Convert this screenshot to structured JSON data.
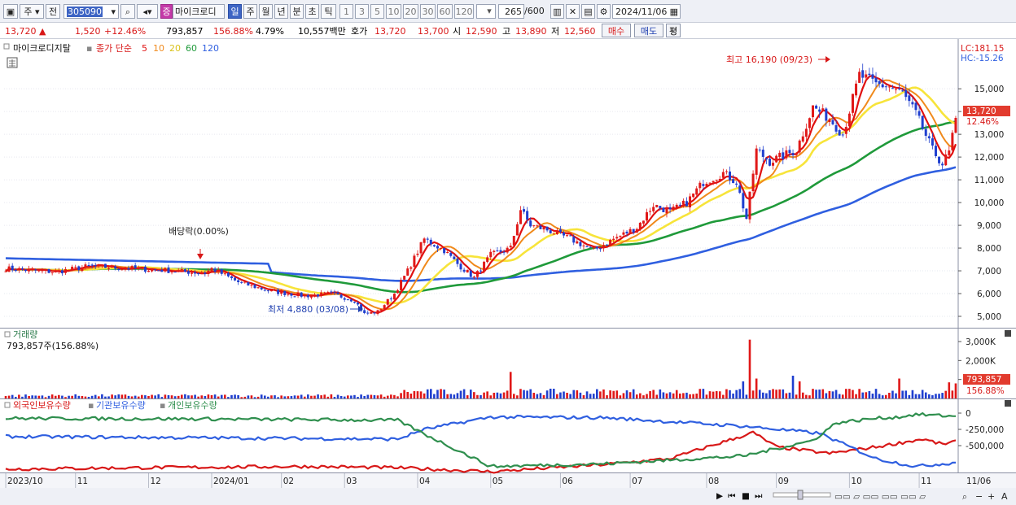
{
  "toolbar": {
    "mode_label": "주",
    "prev_label": "전",
    "code": "305090",
    "stock_badge": "증",
    "stock_name": "마이크로디",
    "periods": [
      "일",
      "주",
      "월",
      "년",
      "분",
      "초",
      "틱"
    ],
    "active_period": "일",
    "intervals": [
      "1",
      "3",
      "5",
      "10",
      "20",
      "30",
      "60",
      "120"
    ],
    "count": "265",
    "total": "/600",
    "date": "2024/11/06"
  },
  "quote": {
    "price": "13,720",
    "change": "1,520",
    "change_pct": "+12.46%",
    "volume": "793,857",
    "volume_ratio": "156.88%",
    "turnover": "4.79%",
    "amount": "10,557백만",
    "hoga_label": "호가",
    "ask": "13,720",
    "bid": "13,700",
    "open_label": "시",
    "open": "12,590",
    "high_label": "고",
    "high": "13,890",
    "low_label": "저",
    "low": "12,560",
    "buy_label": "매수",
    "sell_label": "매도",
    "eval_label": "평"
  },
  "chart_data": [
    {
      "type": "candlestick",
      "name_label": "마이크로디지탈",
      "ma_label": "종가 단순",
      "ma_periods": [
        "5",
        "10",
        "20",
        "60",
        "120"
      ],
      "ma_colors": [
        "#e01010",
        "#f08a1c",
        "#f7e43a",
        "#1f9a3a",
        "#2f5fe0"
      ],
      "lc": "LC:181.15",
      "hc": "HC:-15.26",
      "price_axis_ticks": [
        "15,000",
        "14,000",
        "13,000",
        "12,000",
        "11,000",
        "10,000",
        "9,000",
        "8,000",
        "7,000",
        "6,000",
        "5,000"
      ],
      "ylim": [
        4500,
        16900
      ],
      "current_price": "13,720",
      "current_pct": "12.46%",
      "annotations": {
        "high": "최고 16,190 (09/23)",
        "low": "최저 4,880 (03/08)",
        "dividend": "배당락(0.00%)"
      },
      "x_labels": [
        "2023/10",
        "11",
        "12",
        "2024/01",
        "02",
        "03",
        "04",
        "05",
        "06",
        "07",
        "08",
        "09",
        "10",
        "11",
        "11/06"
      ],
      "anchors": [
        {
          "d": 0,
          "p": 7100
        },
        {
          "d": 15,
          "p": 6950
        },
        {
          "d": 25,
          "p": 7200
        },
        {
          "d": 45,
          "p": 7050
        },
        {
          "d": 60,
          "p": 6900
        },
        {
          "d": 62,
          "p": 7100
        },
        {
          "d": 70,
          "p": 6500
        },
        {
          "d": 80,
          "p": 6100
        },
        {
          "d": 90,
          "p": 5900
        },
        {
          "d": 98,
          "p": 6000
        },
        {
          "d": 105,
          "p": 5700
        },
        {
          "d": 108,
          "p": 5100
        },
        {
          "d": 112,
          "p": 5200
        },
        {
          "d": 117,
          "p": 6000
        },
        {
          "d": 121,
          "p": 7000
        },
        {
          "d": 126,
          "p": 8400
        },
        {
          "d": 132,
          "p": 7900
        },
        {
          "d": 136,
          "p": 7300
        },
        {
          "d": 141,
          "p": 6700
        },
        {
          "d": 146,
          "p": 7700
        },
        {
          "d": 152,
          "p": 8000
        },
        {
          "d": 155,
          "p": 9700
        },
        {
          "d": 158,
          "p": 9000
        },
        {
          "d": 163,
          "p": 8800
        },
        {
          "d": 170,
          "p": 8400
        },
        {
          "d": 177,
          "p": 7900
        },
        {
          "d": 183,
          "p": 8400
        },
        {
          "d": 190,
          "p": 8900
        },
        {
          "d": 195,
          "p": 9900
        },
        {
          "d": 200,
          "p": 9600
        },
        {
          "d": 205,
          "p": 10000
        },
        {
          "d": 210,
          "p": 10900
        },
        {
          "d": 216,
          "p": 11300
        },
        {
          "d": 220,
          "p": 10900
        },
        {
          "d": 223,
          "p": 9300
        },
        {
          "d": 226,
          "p": 12300
        },
        {
          "d": 230,
          "p": 11800
        },
        {
          "d": 238,
          "p": 12300
        },
        {
          "d": 243,
          "p": 14200
        },
        {
          "d": 248,
          "p": 13700
        },
        {
          "d": 252,
          "p": 13000
        },
        {
          "d": 257,
          "p": 15600
        },
        {
          "d": 262,
          "p": 15200
        },
        {
          "d": 266,
          "p": 15100
        },
        {
          "d": 270,
          "p": 14800
        },
        {
          "d": 274,
          "p": 13900
        },
        {
          "d": 279,
          "p": 12300
        },
        {
          "d": 282,
          "p": 11700
        },
        {
          "d": 284,
          "p": 12200
        },
        {
          "d": 286,
          "p": 13720
        }
      ]
    },
    {
      "type": "bar",
      "title": "거래량",
      "summary": "793,857주(156.88%)",
      "y_ticks": [
        "3,000K",
        "2,000K",
        "1,000K"
      ],
      "ylim": [
        0,
        3600
      ],
      "unit": "K",
      "current": "793,857",
      "current_pct": "156.88%",
      "baseline": 140,
      "spikes": [
        {
          "d": 152,
          "v": 1400
        },
        {
          "d": 222,
          "v": 900
        },
        {
          "d": 224,
          "v": 3100
        },
        {
          "d": 226,
          "v": 1050
        },
        {
          "d": 237,
          "v": 1200
        },
        {
          "d": 239,
          "v": 900
        },
        {
          "d": 269,
          "v": 1050
        },
        {
          "d": 284,
          "v": 850
        },
        {
          "d": 286,
          "v": 794
        }
      ]
    },
    {
      "type": "line",
      "series": [
        {
          "name": "외국인보유수량",
          "color": "#d81818"
        },
        {
          "name": "기관보유수량",
          "color": "#2f5fe0"
        },
        {
          "name": "개인보유수량",
          "color": "#2f8f4e"
        }
      ],
      "y_ticks": [
        "0",
        "-250,000",
        "-500,000"
      ],
      "ylim": [
        -900000,
        200000
      ]
    }
  ]
}
